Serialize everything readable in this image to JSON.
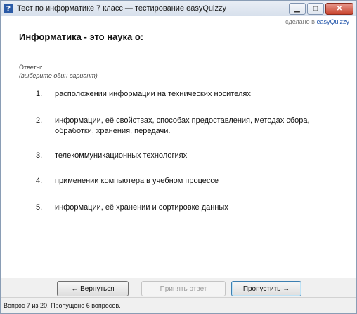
{
  "window": {
    "title": "Тест по информатике 7 класс — тестирование easyQuizzy",
    "icon": "question-icon",
    "controls": [
      "minimize-icon",
      "maximize-icon",
      "close-icon"
    ]
  },
  "header": {
    "made_with_prefix": "сделано в",
    "made_with_link": "easyQuizzy"
  },
  "question": {
    "text": "Информатика - это наука о:",
    "answers_label": "Ответы:",
    "hint": "(выберите один вариант)",
    "options": [
      {
        "num": "1.",
        "text": "расположении информации на технических носителях"
      },
      {
        "num": "2.",
        "text": "информации, её свойствах, способах предоставления, методах сбора, обработки, хранения, передачи."
      },
      {
        "num": "3.",
        "text": "телекоммуникационных технологиях"
      },
      {
        "num": "4.",
        "text": "применении компьютера в учебном процессе"
      },
      {
        "num": "5.",
        "text": "информации, её хранении и сортировке  данных"
      }
    ]
  },
  "buttons": {
    "back": "← Вернуться",
    "accept": "Принять ответ",
    "skip": "Пропустить →"
  },
  "status": {
    "text": "Вопрос 7 из 20. Пропущено 6 вопросов."
  }
}
